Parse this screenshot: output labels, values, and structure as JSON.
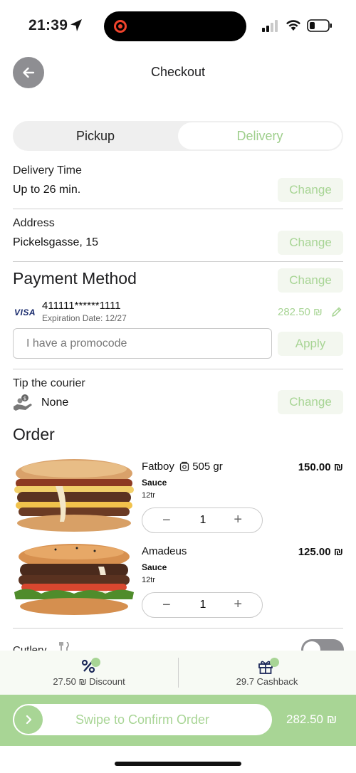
{
  "status_bar": {
    "time": "21:39",
    "icons": [
      "location-arrow-icon",
      "screen-record-icon",
      "cellular-signal-icon",
      "wifi-icon",
      "battery-icon"
    ]
  },
  "header": {
    "title": "Checkout",
    "back_icon": "arrow-left-icon"
  },
  "order_type": {
    "options": [
      "Pickup",
      "Delivery"
    ],
    "selected": "Delivery"
  },
  "delivery_time": {
    "label": "Delivery Time",
    "value": "Up to 26 min.",
    "action": "Change"
  },
  "address": {
    "label": "Address",
    "value": "Pickelsgasse, 15",
    "action": "Change"
  },
  "payment": {
    "title": "Payment Method",
    "action": "Change",
    "card_brand": "VISA",
    "card_number": "411111******1111",
    "expiration": "Expiration Date: 12/27",
    "amount": "282.50 ₪"
  },
  "promo": {
    "placeholder": "I have a promocode",
    "value": "",
    "action": "Apply"
  },
  "tip": {
    "label": "Tip the courier",
    "value": "None",
    "action": "Change"
  },
  "order": {
    "title": "Order",
    "items": [
      {
        "name": "Fatboy",
        "weight": "505 gr",
        "sauce_label": "Sauce",
        "sauce_value": "12tr",
        "price": "150.00 ₪",
        "quantity": "1"
      },
      {
        "name": "Amadeus",
        "sauce_label": "Sauce",
        "sauce_value": "12tr",
        "price": "125.00 ₪",
        "quantity": "1"
      }
    ],
    "stepper": {
      "minus": "−",
      "plus": "+"
    }
  },
  "cutlery": {
    "label": "Cutlery",
    "enabled": false
  },
  "benefits": {
    "discount": "27.50 ₪ Discount",
    "cashback": "29.7 Cashback"
  },
  "confirm": {
    "swipe_label": "Swipe to Confirm Order",
    "total": "282.50 ₪"
  },
  "colors": {
    "accent": "#a8d595",
    "accent_light": "#f3f7ef",
    "back_button": "#8e8e92",
    "toggle_off": "#8e8e92",
    "visa": "#1a2b6d"
  }
}
